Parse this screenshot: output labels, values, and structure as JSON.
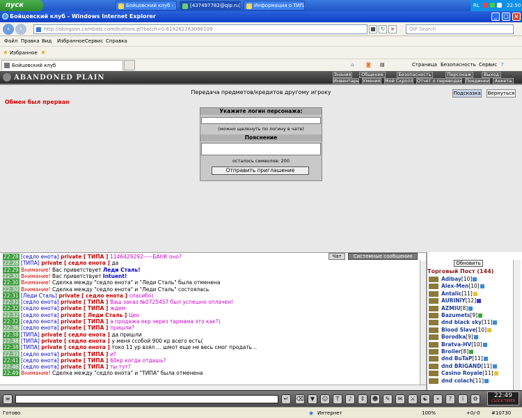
{
  "taskbar": {
    "start": "пуск",
    "tasks": [
      "Бойцовский клуб - ...",
      "[437497782@qip.ru]...",
      "Информация о ТИПА..."
    ],
    "lang": "RL",
    "clock": "22:50"
  },
  "window": {
    "title": "Бойцовский клуб - Windows Internet Explorer"
  },
  "address": {
    "url": "http://skingson.combats.com/buttons.pl?batch=0.619262263098109",
    "search_placeholder": "QIP Search"
  },
  "menu": [
    "Файл",
    "Правка",
    "Вид",
    "Избранное",
    "Сервис",
    "Справка"
  ],
  "favorites": {
    "label": "Избранное"
  },
  "tab": {
    "title": "Бойцовский клуб"
  },
  "commands": {
    "page": "Страница",
    "security": "Безопасность",
    "tools": "Сервис"
  },
  "game": {
    "logo": "ABANDONED PLAIN",
    "nav_row1": [
      "Знания",
      "Общение",
      "Безопасность",
      "Персонаж",
      "Выход"
    ],
    "nav_row2": [
      "Инвентарь",
      "Умения",
      "Мой Скролл",
      "Отчет о переводах",
      "Поединки",
      "Анкета"
    ],
    "transfer_title": "Передача предметов/кредитов другому игроку",
    "btn_hint": "Подсказка",
    "btn_back": "Вернуться",
    "error": "Обмен был прерван",
    "form": {
      "login_header": "Укажите логин персонажа:",
      "login_note": "(можно щелкнуть по логину в чате)",
      "reason_header": "Пояснение",
      "chars_left": "осталось символов: 200",
      "send": "Отправить приглашение"
    }
  },
  "chat": {
    "tab_chat": "Чат",
    "tab_system": "Системные сообщения",
    "lines": [
      {
        "time": "22:28",
        "parts": [
          {
            "c": "#00c",
            "t": "[седло енота] "
          },
          {
            "c": "#c00",
            "b": 1,
            "t": "private [ ТИПА ] "
          },
          {
            "c": "#c0c",
            "t": "1146429292-----БАНК оно?"
          }
        ]
      },
      {
        "time": "22:28",
        "parts": [
          {
            "c": "#00c",
            "t": "[ТИПА] "
          },
          {
            "c": "#c00",
            "b": 1,
            "t": "private [ седло енота ] "
          },
          {
            "c": "#000",
            "t": "да"
          }
        ]
      },
      {
        "time": "22:29",
        "parts": [
          {
            "c": "#c00",
            "t": "Внимание! "
          },
          {
            "c": "#000",
            "t": "Вас приветствует "
          },
          {
            "c": "#00c",
            "b": 1,
            "t": "Леди Сталь!"
          }
        ]
      },
      {
        "time": "22:30",
        "parts": [
          {
            "c": "#c00",
            "t": "Внимание! "
          },
          {
            "c": "#000",
            "t": "Вас приветствует "
          },
          {
            "c": "#00c",
            "b": 1,
            "t": "Intuent!"
          }
        ]
      },
      {
        "time": "22:30",
        "parts": [
          {
            "c": "#c00",
            "t": "Внимание! "
          },
          {
            "c": "#000",
            "t": "Сделка между \"седло енота\" и \"Леди Сталь\" была отменена"
          }
        ]
      },
      {
        "time": "22:30",
        "parts": [
          {
            "c": "#c00",
            "t": "Внимание! "
          },
          {
            "c": "#000",
            "t": "Сделка между \"седло енота\" и \"Леди Сталь\" состоялась"
          }
        ]
      },
      {
        "time": "22:31",
        "parts": [
          {
            "c": "#00c",
            "t": "[Леди Сталь] "
          },
          {
            "c": "#c00",
            "b": 1,
            "t": "private [ седло енота ] "
          },
          {
            "c": "#c0c",
            "t": "спасибо)"
          }
        ]
      },
      {
        "time": "22:31",
        "parts": [
          {
            "c": "#00c",
            "t": "[седло енота] "
          },
          {
            "c": "#c00",
            "b": 1,
            "t": "private [ ТИПА ] "
          },
          {
            "c": "#c0c",
            "t": "Ваш заказ №0725457 был успешно оплачен!"
          }
        ]
      },
      {
        "time": "22:32",
        "parts": [
          {
            "c": "#00c",
            "t": "[седло енота] "
          },
          {
            "c": "#c00",
            "b": 1,
            "t": "private [ ТИПА ] "
          },
          {
            "c": "#c0c",
            "t": "ждем"
          }
        ]
      },
      {
        "time": "22:32",
        "parts": [
          {
            "c": "#00c",
            "t": "[седло енота] "
          },
          {
            "c": "#c00",
            "b": 1,
            "t": "private [ Леди Сталь ] "
          },
          {
            "c": "#c0c",
            "t": "Цен"
          }
        ]
      },
      {
        "time": "22:32",
        "parts": [
          {
            "c": "#00c",
            "t": "[седло енота] "
          },
          {
            "c": "#c00",
            "b": 1,
            "t": "private [ ТИПА ] "
          },
          {
            "c": "#c0c",
            "t": "а продажа екр через тармама это как?)"
          }
        ]
      },
      {
        "time": "22:36",
        "parts": [
          {
            "c": "#00c",
            "t": "[седло енота] "
          },
          {
            "c": "#c00",
            "b": 1,
            "t": "private [ ТИПА ] "
          },
          {
            "c": "#c0c",
            "t": "пришли?"
          }
        ]
      },
      {
        "time": "22:38",
        "parts": [
          {
            "c": "#00c",
            "t": "[ТИПА] "
          },
          {
            "c": "#c00",
            "b": 1,
            "t": "private [ седло енота ] "
          },
          {
            "c": "#000",
            "t": "да пришли"
          }
        ]
      },
      {
        "time": "22:38",
        "parts": [
          {
            "c": "#00c",
            "t": "[ТИПА] "
          },
          {
            "c": "#c00",
            "b": 1,
            "t": "private [ седло енота ] "
          },
          {
            "c": "#000",
            "t": "у меня ссобой 900 кр всего есть("
          }
        ]
      },
      {
        "time": "22:38",
        "parts": [
          {
            "c": "#00c",
            "t": "[ТИПА] "
          },
          {
            "c": "#c00",
            "b": 1,
            "t": "private [ седло енота ] "
          },
          {
            "c": "#000",
            "t": "токо 11 ур взял ... шмот еще не весь смог продать .."
          }
        ]
      },
      {
        "time": "22:39",
        "parts": [
          {
            "c": "#00c",
            "t": "[седло енота] "
          },
          {
            "c": "#c00",
            "b": 1,
            "t": "private [ ТИПА ] "
          },
          {
            "c": "#c0c",
            "t": "и?"
          }
        ]
      },
      {
        "time": "22:41",
        "parts": [
          {
            "c": "#00c",
            "t": "[седло енота] "
          },
          {
            "c": "#c00",
            "b": 1,
            "t": "private [ ТИПА ] "
          },
          {
            "c": "#c0c",
            "t": "60кр когда отдашь?"
          }
        ]
      },
      {
        "time": "22:46",
        "parts": [
          {
            "c": "#00c",
            "t": "[седло енота] "
          },
          {
            "c": "#c00",
            "b": 1,
            "t": "private [ ТИПА ] "
          },
          {
            "c": "#c0c",
            "t": "ты тут?"
          }
        ]
      },
      {
        "time": "22:49",
        "parts": [
          {
            "c": "#c00",
            "t": "Внимание! "
          },
          {
            "c": "#000",
            "t": "Сделка между \"седло енота\" и \"ТИПА\" была отменена"
          }
        ]
      }
    ]
  },
  "users": {
    "refresh": "Обновить",
    "title": "Торговый Пост (144)",
    "list": [
      {
        "name": "Adibay",
        "lvl": "[10]",
        "badge": "#3a8ad8"
      },
      {
        "name": "Alex-Men",
        "lvl": "[10]",
        "badge": "#3a8ad8"
      },
      {
        "name": "Antalic",
        "lvl": "[11]",
        "badge": "#e8c030"
      },
      {
        "name": "AURINIY",
        "lvl": "[12]",
        "badge": "#3a3ad8"
      },
      {
        "name": "AZMIU",
        "lvl": "[8]",
        "badge": "#3a8ad8"
      },
      {
        "name": "Bazumets",
        "lvl": "[9]",
        "badge": "#3aa83a"
      },
      {
        "name": "dnd black sky",
        "lvl": "[11]",
        "badge": "#3a8ad8"
      },
      {
        "name": "Blood Slave",
        "lvl": "[10]",
        "badge": "#e8c030"
      },
      {
        "name": "Borodka",
        "lvl": "[9]",
        "badge": "#3a8ad8"
      },
      {
        "name": "Bratva-HV",
        "lvl": "[10]",
        "badge": "#3a8ad8"
      },
      {
        "name": "Broiler",
        "lvl": "[8]",
        "badge": "#3aa83a"
      },
      {
        "name": "dnd BuTaP",
        "lvl": "[11]",
        "badge": "#3a8ad8"
      },
      {
        "name": "dnd BRIGAND",
        "lvl": "[11]",
        "badge": "#3a8ad8"
      },
      {
        "name": "Casino Royale",
        "lvl": "[11]",
        "badge": "#e8c030"
      },
      {
        "name": "dnd colach",
        "lvl": "[11]",
        "badge": "#3a8ad8"
      }
    ]
  },
  "bottom_clock": {
    "time": "22:49",
    "label": "CLOCK TIMER"
  },
  "status": {
    "left": "Готово",
    "zone": "Интернет",
    "zoom": "100%",
    "right": "+0/-0",
    "code": "#10730"
  }
}
